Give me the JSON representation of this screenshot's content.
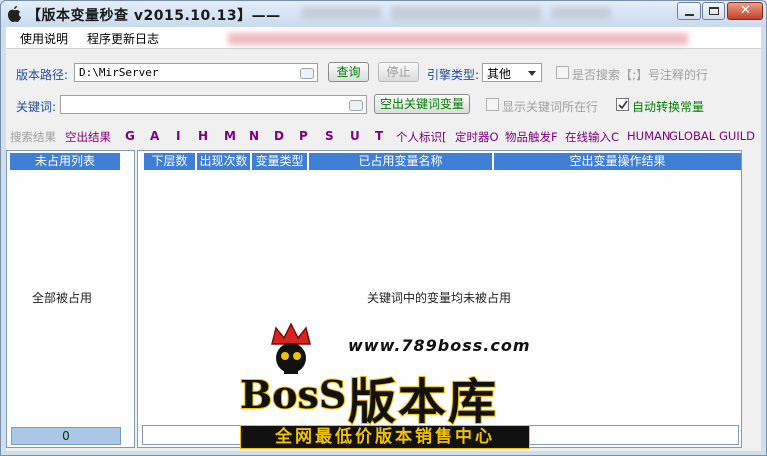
{
  "window": {
    "title": "【版本变量秒查 v2015.10.13】——",
    "buttons": {
      "minimize": "minimize",
      "maximize": "maximize",
      "close": "close"
    }
  },
  "menu": {
    "items": [
      "使用说明",
      "程序更新日志"
    ]
  },
  "toolbar": {
    "path_label": "版本路径:",
    "path_value": "D:\\MirServer",
    "query_button": "查询",
    "stop_button": "停止",
    "engine_label": "引擎类型:",
    "engine_value": "其他",
    "search_comment_label": "是否搜索【;】号注释的行",
    "keyword_label": "关键词:",
    "keyword_value": "",
    "clear_keyword_button": "空出关键词变量",
    "show_keyword_rows_label": "显示关键词所在行",
    "auto_convert_label": "自动转换常量",
    "auto_convert_checked": true
  },
  "filters": {
    "label": "搜索结果",
    "items": [
      "空出结果",
      "G",
      "A",
      "I",
      "H",
      "M",
      "N",
      "D",
      "P",
      "S",
      "U",
      "T",
      "个人标识[",
      "定时器O",
      "物品触发F",
      "在线输入C",
      "HUMAN",
      "GLOBAL",
      "GUILD"
    ]
  },
  "left_panel": {
    "header": "未占用列表",
    "message": "全部被占用",
    "count": "0"
  },
  "table": {
    "columns": [
      "下层数",
      "出现次数",
      "变量类型",
      "已占用变量名称",
      "空出变量操作结果"
    ],
    "empty_message": "关键词中的变量均未被占用"
  },
  "watermark": {
    "url": "www.789boss.com",
    "boss": "BosS",
    "brand": "版本库",
    "slogan": "全网最低价版本销售中心"
  },
  "colors": {
    "header_blue": "#3f7fd6",
    "label_blue": "#1f4fa0",
    "button_green": "#008000",
    "filter_purple": "#800080",
    "watermark_gold": "#f2c200"
  }
}
